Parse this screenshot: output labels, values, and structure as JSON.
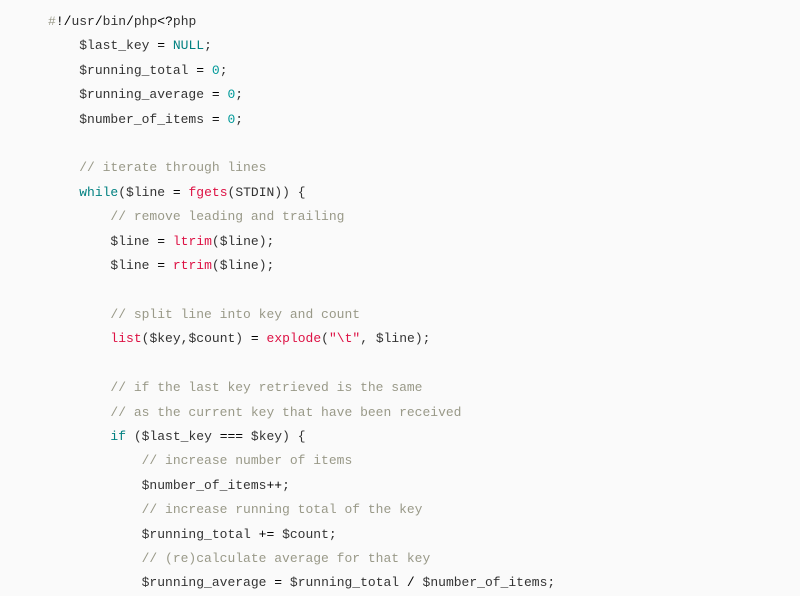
{
  "shebang": {
    "hash": "#",
    "bang": "!",
    "p1": "usr",
    "p2": "bin",
    "p3": "php",
    "open": "?",
    "php": "php"
  },
  "l2": {
    "var": "$last_key",
    "null": "NULL"
  },
  "l3": {
    "var": "$running_total",
    "zero": "0"
  },
  "l4": {
    "var": "$running_average",
    "zero": "0"
  },
  "l5": {
    "var": "$number_of_items",
    "zero": "0"
  },
  "c_iterate": "// iterate through lines",
  "while_kw": "while",
  "line_var": "$line",
  "fgets_fn": "fgets",
  "stdin_const": "STDIN",
  "c_remove": "// remove leading and trailing",
  "ltrim_fn": "ltrim",
  "rtrim_fn": "rtrim",
  "c_split": "// split line into key and count",
  "list_fn": "list",
  "key_var": "$key",
  "count_var": "$count",
  "explode_fn": "explode",
  "tab_str": "\"\\t\"",
  "c_if1": "// if the last key retrieved is the same",
  "c_if2": "// as the current key that have been received",
  "if_kw": "if",
  "lastkey_var": "$last_key",
  "triple_eq": "===",
  "c_inc_items": "// increase number of items",
  "num_items_var": "$number_of_items",
  "plusplus": "++",
  "c_inc_total": "// increase running total of the key",
  "running_total_var": "$running_total",
  "pluseq": "+=",
  "c_recalc": "// (re)calculate average for that key",
  "running_avg_var": "$running_average",
  "slash": "/",
  "eq": "=",
  "semi": ";",
  "comma": ",",
  "lpar": "(",
  "rpar": ")",
  "lbrace": "{",
  "sep": "/",
  "lt": "<"
}
